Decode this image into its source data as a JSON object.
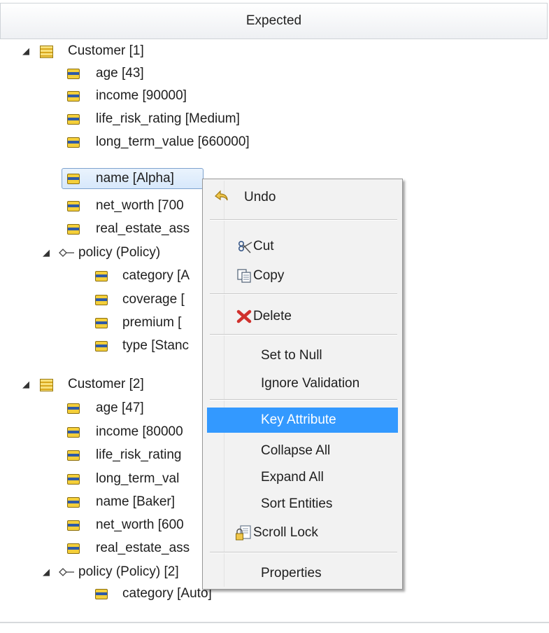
{
  "header": {
    "title": "Expected"
  },
  "tree": {
    "customer1": {
      "label": "Customer [1]",
      "attrs": [
        "age [43]",
        "income [90000]",
        "life_risk_rating [Medium]",
        "long_term_value [660000]",
        "name [Alpha]",
        "net_worth [700",
        "real_estate_ass"
      ],
      "policy": {
        "label": "policy (Policy)",
        "attrs": [
          "category [A",
          "coverage [",
          "premium [",
          "type [Stanc"
        ]
      }
    },
    "customer2": {
      "label": "Customer [2]",
      "attrs": [
        "age [47]",
        "income [80000",
        "life_risk_rating",
        "long_term_val",
        "name [Baker]",
        "net_worth [600",
        "real_estate_ass"
      ],
      "policy": {
        "label": "policy (Policy) [2]",
        "attrs": [
          "category [Auto]"
        ]
      }
    }
  },
  "menu": {
    "undo": "Undo",
    "cut": "Cut",
    "copy": "Copy",
    "delete": "Delete",
    "set_null": "Set to Null",
    "ignore_validation": "Ignore Validation",
    "key_attribute": "Key Attribute",
    "collapse_all": "Collapse All",
    "expand_all": "Expand All",
    "sort_entities": "Sort Entities",
    "scroll_lock": "Scroll Lock",
    "properties": "Properties"
  },
  "colors": {
    "highlight": "#3399ff",
    "selection_border": "#7da2ce"
  }
}
